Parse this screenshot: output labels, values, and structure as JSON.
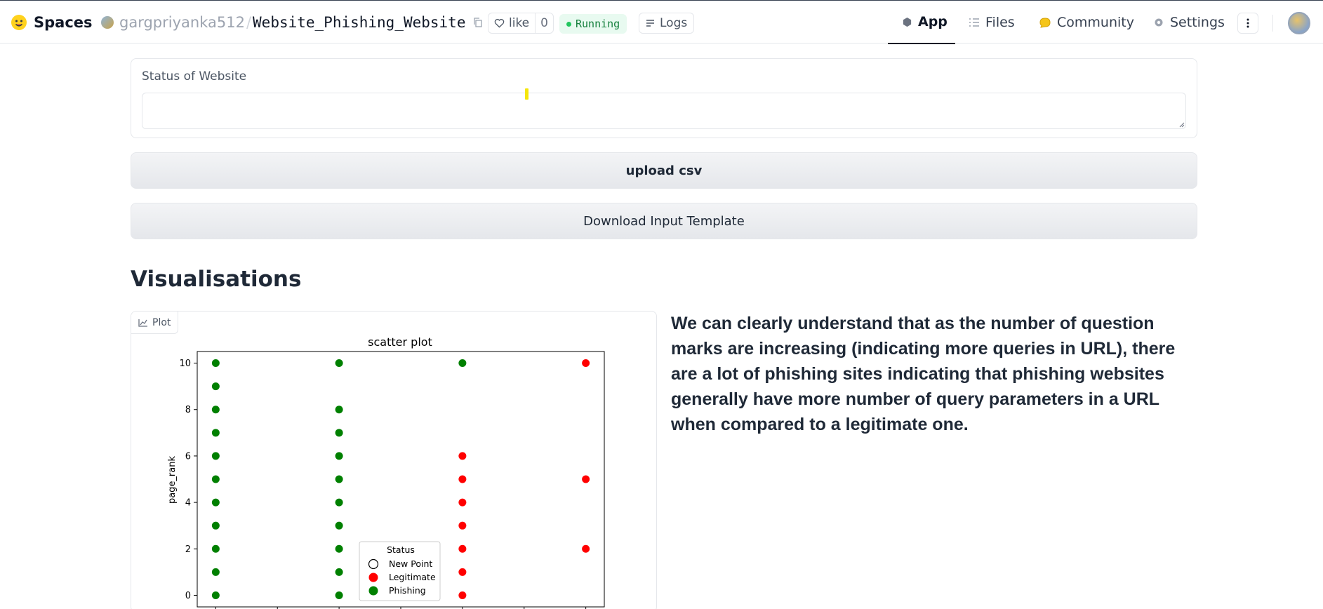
{
  "header": {
    "brand": "Spaces",
    "owner": "gargpriyanka512",
    "separator": "/",
    "repo_name": "Website_Phishing_Website",
    "like_label": "like",
    "like_count": "0",
    "status": "Running",
    "logs_label": "Logs",
    "nav": {
      "app": "App",
      "files": "Files",
      "community": "Community",
      "settings": "Settings"
    }
  },
  "status_panel": {
    "label": "Status of Website",
    "value": ""
  },
  "buttons": {
    "upload": "upload csv",
    "download": "Download Input Template"
  },
  "visualisations": {
    "title": "Visualisations",
    "plot_tab": "Plot",
    "description": "We can clearly understand that as the number of question marks are increasing (indicating more queries in URL), there are a lot of phishing sites indicating that phishing websites generally have more number of query parameters in a URL when compared to a legitimate one."
  },
  "colors": {
    "phishing": "#008000",
    "legitimate": "#ff0000",
    "running_bg": "#e8faf0",
    "running_text": "#15803d"
  },
  "chart_data": {
    "type": "scatter",
    "title": "scatter plot",
    "xlabel": "",
    "ylabel": "page_rank",
    "ylim": [
      -0.5,
      10.5
    ],
    "xlim": [
      -0.15,
      3.15
    ],
    "yticks": [
      "0",
      "2",
      "4",
      "6",
      "8",
      "10"
    ],
    "legend": {
      "title": "Status",
      "placement": "lower-center",
      "entries": [
        "New Point",
        "Legitimate",
        "Phishing"
      ]
    },
    "series": [
      {
        "name": "Phishing",
        "color": "#008000",
        "points": [
          [
            0,
            10
          ],
          [
            0,
            9
          ],
          [
            0,
            8
          ],
          [
            0,
            7
          ],
          [
            0,
            6
          ],
          [
            0,
            5
          ],
          [
            0,
            4
          ],
          [
            0,
            3
          ],
          [
            0,
            2
          ],
          [
            0,
            1
          ],
          [
            0,
            0
          ],
          [
            1,
            10
          ],
          [
            1,
            8
          ],
          [
            1,
            7
          ],
          [
            1,
            6
          ],
          [
            1,
            5
          ],
          [
            1,
            4
          ],
          [
            1,
            3
          ],
          [
            1,
            2
          ],
          [
            1,
            1
          ],
          [
            1,
            0
          ],
          [
            2,
            10
          ]
        ]
      },
      {
        "name": "Legitimate",
        "color": "#ff0000",
        "points": [
          [
            2,
            6
          ],
          [
            2,
            5
          ],
          [
            2,
            4
          ],
          [
            2,
            3
          ],
          [
            2,
            2
          ],
          [
            2,
            1
          ],
          [
            2,
            0
          ],
          [
            3,
            10
          ],
          [
            3,
            5
          ],
          [
            3,
            2
          ]
        ]
      }
    ]
  }
}
